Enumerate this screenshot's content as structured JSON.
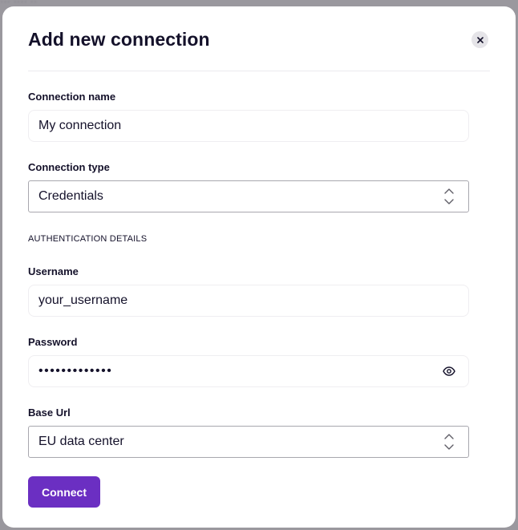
{
  "dialog": {
    "title": "Add new connection"
  },
  "form": {
    "connection_name": {
      "label": "Connection name",
      "value": "My connection"
    },
    "connection_type": {
      "label": "Connection type",
      "value": "Credentials"
    },
    "section_heading": "AUTHENTICATION DETAILS",
    "username": {
      "label": "Username",
      "value": "your_username"
    },
    "password": {
      "label": "Password",
      "value": "•••••••••••••"
    },
    "base_url": {
      "label": "Base Url",
      "value": "EU data center"
    }
  },
  "actions": {
    "connect_label": "Connect"
  },
  "colors": {
    "accent": "#6b2fc2",
    "text": "#14112a",
    "backdrop": "#9a989e"
  },
  "icons": {
    "close": "close-icon",
    "select_arrows": "chevron-up-down-icon",
    "show_password": "eye-icon"
  }
}
